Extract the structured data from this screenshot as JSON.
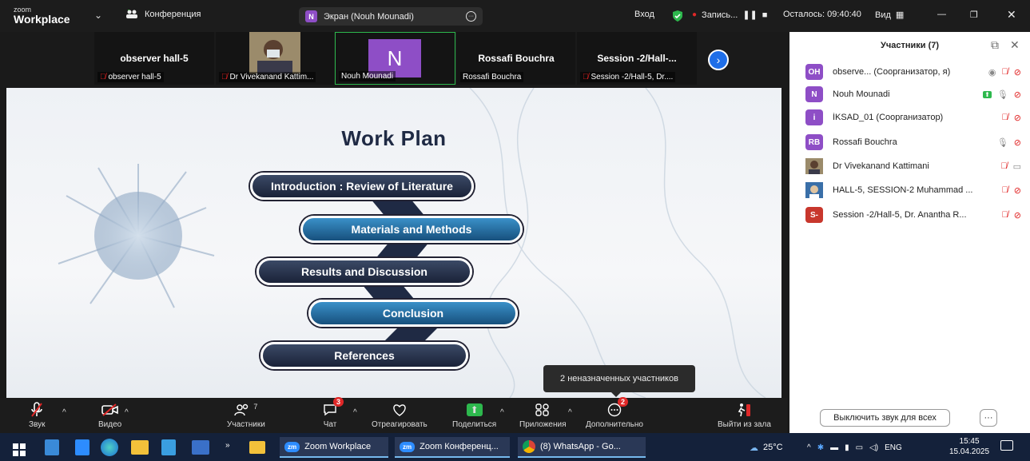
{
  "window": {
    "logo_top": "zoom",
    "logo_bottom": "Workplace",
    "meeting_label": "Конференция",
    "share_badge": "N",
    "share_label": "Экран (Nouh Mounadi)",
    "signin": "Вход",
    "recording": "Запись...",
    "timer": "Осталось: 09:40:40",
    "view": "Вид"
  },
  "thumbnails": [
    {
      "title": "observer hall-5",
      "label": "observer hall-5",
      "muted": true
    },
    {
      "title": "",
      "label": "Dr Vivekanand Kattim...",
      "muted": true
    },
    {
      "title": "N",
      "label": "Nouh Mounadi",
      "muted": false
    },
    {
      "title": "Rossafi Bouchra",
      "label": "Rossafi Bouchra",
      "muted": false
    },
    {
      "title": "Session -2/Hall-...",
      "label": "Session -2/Hall-5, Dr....",
      "muted": true
    }
  ],
  "slide": {
    "title": "Work Plan",
    "items": [
      "Introduction : Review of Literature",
      "Materials and Methods",
      "Results and Discussion",
      "Conclusion",
      "References"
    ]
  },
  "tooltip": "2 неназначенных участников",
  "toolbar": {
    "audio": "Звук",
    "video": "Видео",
    "participants": "Участники",
    "participants_count": "7",
    "chat": "Чат",
    "chat_badge": "3",
    "react": "Отреагировать",
    "share": "Поделиться",
    "apps": "Приложения",
    "more": "Дополнительно",
    "more_badge": "2",
    "leave": "Выйти из зала"
  },
  "panel": {
    "title": "Участники (7)",
    "participants": [
      {
        "initials": "OH",
        "color": "#8e4ec6",
        "name": "observe... (Соорганизатор, я)"
      },
      {
        "initials": "N",
        "color": "#8e4ec6",
        "name": "Nouh Mounadi"
      },
      {
        "initials": "i",
        "color": "#8e4ec6",
        "name": "İKSAD_01 (Соорганизатор)"
      },
      {
        "initials": "RB",
        "color": "#8e4ec6",
        "name": "Rossafi Bouchra"
      },
      {
        "initials": "",
        "color": "#6b5a3a",
        "name": "Dr Vivekanand Kattimani"
      },
      {
        "initials": "",
        "color": "#4a6a8a",
        "name": "HALL-5, SESSION-2 Muhammad ..."
      },
      {
        "initials": "S-",
        "color": "#c8372d",
        "name": "Session -2/Hall-5, Dr. Anantha R..."
      }
    ],
    "mute_all": "Выключить звук для всех",
    "more": "···"
  },
  "taskbar": {
    "apps": [
      {
        "label": "Zoom Workplace"
      },
      {
        "label": "Zoom Конференц..."
      },
      {
        "label": "(8) WhatsApp - Go..."
      }
    ],
    "weather": "25°C",
    "lang": "ENG",
    "time": "15:45",
    "date": "15.04.2025"
  }
}
